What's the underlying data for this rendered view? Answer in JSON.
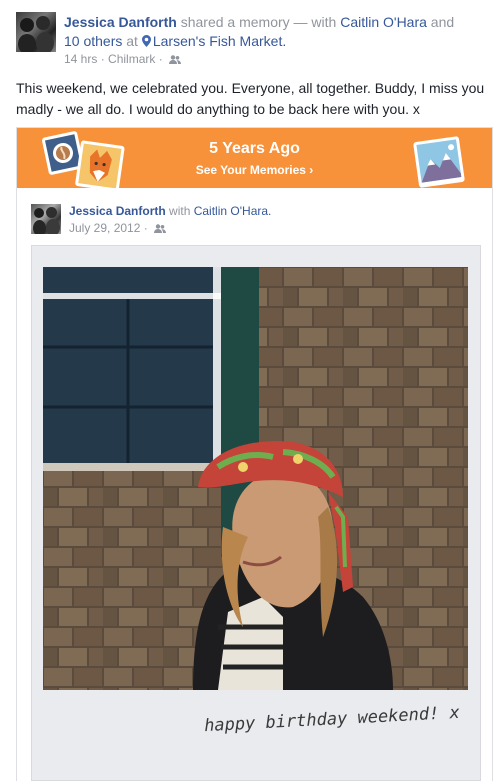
{
  "post": {
    "author": "Jessica Danforth",
    "action": " shared a memory — with ",
    "tagged_person": "Caitlin O'Hara",
    "and_text": " and ",
    "others": "10 others",
    "at_text": " at ",
    "location": "Larsen's Fish Market.",
    "time": "14 hrs",
    "separator": " · ",
    "place": "Chilmark",
    "separator2": " · ",
    "text": "This weekend, we celebrated you. Everyone, all together. Buddy, I miss you madly - we all do. I would do anything to be back here with you. x"
  },
  "memory": {
    "title": "5 Years Ago",
    "link": "See Your Memories ›",
    "inner_author": "Jessica Danforth",
    "inner_with": " with ",
    "inner_tagged": "Caitlin O'Hara.",
    "inner_date": "July 29, 2012",
    "inner_sep": " · ",
    "photo_caption": "happy birthday weekend! x"
  },
  "colors": {
    "link": "#365899",
    "meta": "#90949c",
    "banner": "#f7923a"
  },
  "icons": {
    "location": "pin-icon",
    "audience": "friends-icon"
  }
}
